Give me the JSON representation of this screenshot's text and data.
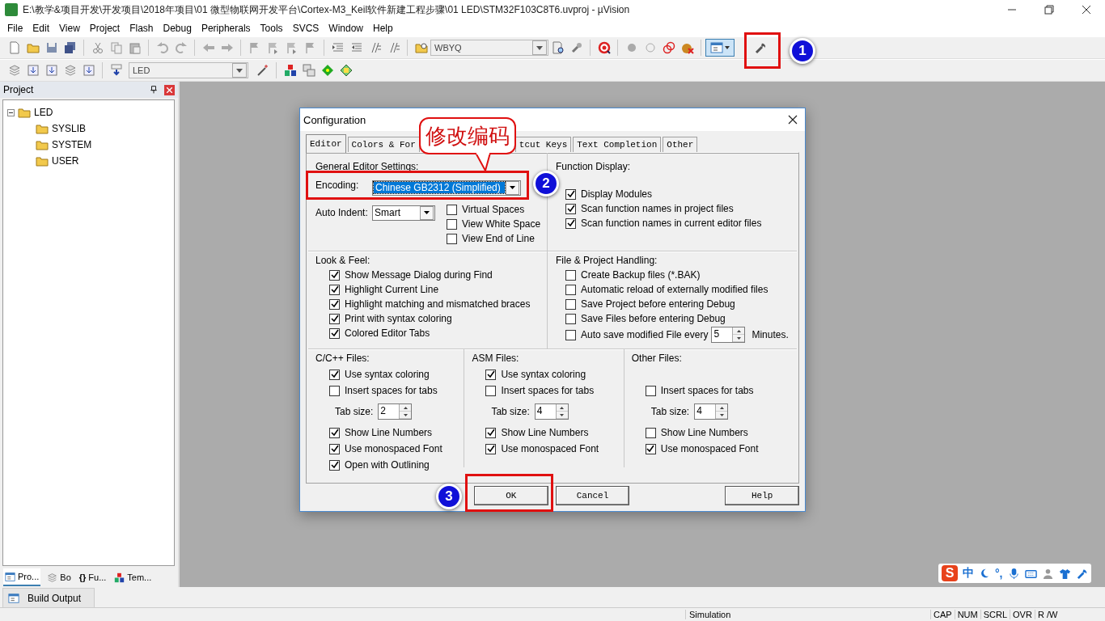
{
  "window": {
    "title": "E:\\教学&项目开发\\开发项目\\2018年项目\\01 微型物联网开发平台\\Cortex-M3_Keil软件新建工程步骤\\01 LED\\STM32F103C8T6.uvproj - µVision"
  },
  "menu": [
    "File",
    "Edit",
    "View",
    "Project",
    "Flash",
    "Debug",
    "Peripherals",
    "Tools",
    "SVCS",
    "Window",
    "Help"
  ],
  "toolbar": {
    "find_combo": "WBYQ"
  },
  "build_toolbar": {
    "target": "LED"
  },
  "project_panel": {
    "title": "Project",
    "tree": [
      {
        "label": "LED",
        "expanded": true,
        "children": [
          {
            "label": "SYSLIB"
          },
          {
            "label": "SYSTEM"
          },
          {
            "label": "USER"
          }
        ]
      }
    ],
    "tabs": [
      {
        "label": "Pro...",
        "selected": true
      },
      {
        "label": "Bo",
        "selected": false
      },
      {
        "label": "Fu...",
        "glyph": "{}",
        "selected": false
      },
      {
        "label": "Tem...",
        "selected": false
      }
    ]
  },
  "output_tab": {
    "label": "Build Output"
  },
  "status_bar": {
    "mode": "Simulation",
    "indicators": [
      "CAP",
      "NUM",
      "SCRL",
      "OVR",
      "R /W"
    ]
  },
  "ime_bar": {
    "logo": "S",
    "mode": "中",
    "punctuation": "°,"
  },
  "dialog": {
    "title": "Configuration",
    "tabs": [
      {
        "label": "Editor",
        "selected": true
      },
      {
        "label": "Colors & For",
        "selected": false
      },
      {
        "label": "tcut Keys",
        "selected": false
      },
      {
        "label": "Text Completion",
        "selected": false
      },
      {
        "label": "Other",
        "selected": false
      }
    ],
    "general": {
      "title": "General Editor Settings:",
      "encoding_label": "Encoding:",
      "encoding": "Chinese GB2312 (Simplified)",
      "indent_label": "Auto Indent:",
      "indent": "Smart",
      "options": [
        {
          "label": "Virtual Spaces",
          "checked": false
        },
        {
          "label": "View White Space",
          "checked": false
        },
        {
          "label": "View End of Line",
          "checked": false
        }
      ]
    },
    "function_display": {
      "title": "Function Display:",
      "options": [
        {
          "label": "Display Modules",
          "checked": true
        },
        {
          "label": "Scan function names in project files",
          "checked": true
        },
        {
          "label": "Scan function names in current editor files",
          "checked": true
        }
      ]
    },
    "look_feel": {
      "title": "Look & Feel:",
      "options": [
        {
          "label": "Show Message Dialog during Find",
          "checked": true
        },
        {
          "label": "Highlight Current Line",
          "checked": true
        },
        {
          "label": "Highlight matching and mismatched braces",
          "checked": true
        },
        {
          "label": "Print with syntax coloring",
          "checked": true
        },
        {
          "label": "Colored Editor Tabs",
          "checked": true
        }
      ]
    },
    "file_handling": {
      "title": "File & Project Handling:",
      "options": [
        {
          "label": "Create Backup files (*.BAK)",
          "checked": false
        },
        {
          "label": "Automatic reload of externally modified files",
          "checked": false
        },
        {
          "label": "Save Project before entering Debug",
          "checked": false
        },
        {
          "label": "Save Files before entering Debug",
          "checked": false
        }
      ],
      "autosave": {
        "label": "Auto save modified File every",
        "checked": false,
        "value": "5",
        "unit": "Minutes."
      }
    },
    "file_groups": [
      {
        "title": "C/C++ Files:",
        "items": [
          {
            "kind": "checkbox",
            "label": "Use syntax coloring",
            "checked": true
          },
          {
            "kind": "checkbox",
            "label": "Insert spaces for tabs",
            "checked": false
          },
          {
            "kind": "tabsize",
            "label": "Tab size:",
            "value": "2"
          },
          {
            "kind": "checkbox",
            "label": "Show Line Numbers",
            "checked": true
          },
          {
            "kind": "checkbox",
            "label": "Use monospaced Font",
            "checked": true
          },
          {
            "kind": "checkbox",
            "label": "Open with Outlining",
            "checked": true
          }
        ]
      },
      {
        "title": "ASM Files:",
        "items": [
          {
            "kind": "checkbox",
            "label": "Use syntax coloring",
            "checked": true
          },
          {
            "kind": "checkbox",
            "label": "Insert spaces for tabs",
            "checked": false
          },
          {
            "kind": "tabsize",
            "label": "Tab size:",
            "value": "4"
          },
          {
            "kind": "checkbox",
            "label": "Show Line Numbers",
            "checked": true
          },
          {
            "kind": "checkbox",
            "label": "Use monospaced Font",
            "checked": true
          }
        ]
      },
      {
        "title": "Other Files:",
        "items": [
          {
            "kind": "gap"
          },
          {
            "kind": "checkbox",
            "label": "Insert spaces for tabs",
            "checked": false
          },
          {
            "kind": "tabsize",
            "label": "Tab size:",
            "value": "4"
          },
          {
            "kind": "checkbox",
            "label": "Show Line Numbers",
            "checked": false
          },
          {
            "kind": "checkbox",
            "label": "Use monospaced Font",
            "checked": true
          }
        ]
      }
    ],
    "buttons": [
      {
        "label": "OK"
      },
      {
        "label": "Cancel"
      },
      {
        "label": "Help"
      }
    ]
  },
  "annotations": {
    "callout": "修改编码",
    "markers": [
      "1",
      "2",
      "3"
    ]
  }
}
